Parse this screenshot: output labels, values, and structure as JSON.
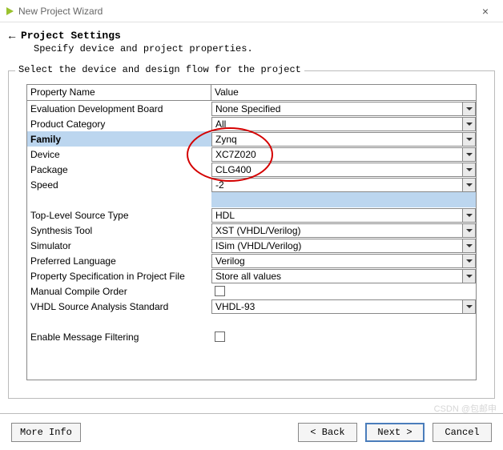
{
  "window": {
    "title": "New Project Wizard"
  },
  "header": {
    "title": "Project Settings",
    "sub": "Specify device and project properties."
  },
  "group": {
    "label": "Select the device and design flow for the project"
  },
  "grid": {
    "head_prop": "Property Name",
    "head_val": "Value",
    "rows": [
      {
        "label": "Evaluation Development Board",
        "value": "None Specified",
        "dd": true
      },
      {
        "label": "Product Category",
        "value": "All",
        "dd": true
      },
      {
        "label": "Family",
        "value": "Zynq",
        "dd": true,
        "selected": true
      },
      {
        "label": "Device",
        "value": "XC7Z020",
        "dd": true
      },
      {
        "label": "Package",
        "value": "CLG400",
        "dd": true
      },
      {
        "label": "Speed",
        "value": "-2",
        "dd": true
      },
      {
        "filler": true
      },
      {
        "label": "Top-Level Source Type",
        "value": "HDL",
        "dd": true
      },
      {
        "label": "Synthesis Tool",
        "value": "XST (VHDL/Verilog)",
        "dd": true
      },
      {
        "label": "Simulator",
        "value": "ISim (VHDL/Verilog)",
        "dd": true
      },
      {
        "label": "Preferred Language",
        "value": "Verilog",
        "dd": true
      },
      {
        "label": "Property Specification in Project File",
        "value": "Store all values",
        "dd": true
      },
      {
        "label": "Manual Compile Order",
        "check": true
      },
      {
        "label": "VHDL Source Analysis Standard",
        "value": "VHDL-93",
        "dd": true
      },
      {
        "spacer": true
      },
      {
        "label": "Enable Message Filtering",
        "check": true
      }
    ]
  },
  "footer": {
    "more": "More Info",
    "back": "< Back",
    "next": "Next >",
    "cancel": "Cancel"
  },
  "watermark": "CSDN @包邮申"
}
